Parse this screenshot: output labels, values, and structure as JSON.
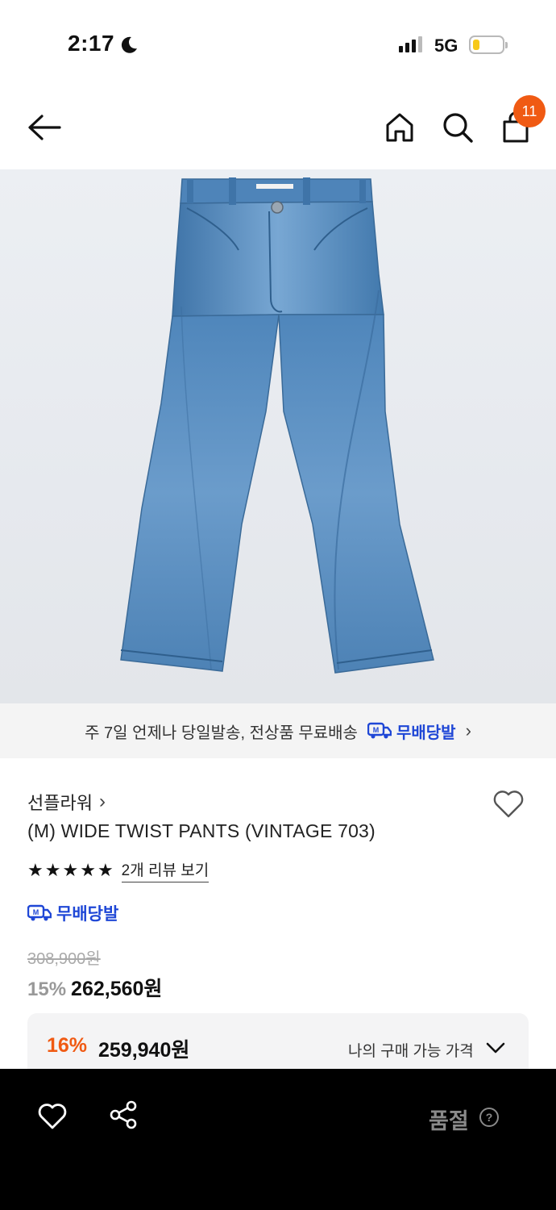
{
  "status_bar": {
    "time": "2:17",
    "network": "5G"
  },
  "top_nav": {
    "cart_count": "11"
  },
  "shipping_banner": {
    "text": "주 7일 언제나 당일발송, 전상품 무료배송",
    "badge_label": "무배당발",
    "badge_icon_text": "M"
  },
  "product": {
    "brand": "선플라워",
    "brand_chevron": "›",
    "name": "(M) WIDE TWIST PANTS (VINTAGE 703)",
    "rating_stars": 5,
    "review_link": "2개 리뷰 보기",
    "tag_label": "무배당발",
    "tag_icon_text": "M",
    "original_price": "308,900원",
    "discount_rate": "15%",
    "sale_price": "262,560원"
  },
  "my_price": {
    "rate": "16%",
    "price": "259,940원",
    "label": "나의 구매 가능 가격"
  },
  "bottom_bar": {
    "status_label": "품절"
  },
  "colors": {
    "accent_orange": "#f05a13",
    "mubae_blue": "#1f47d6",
    "denim": "#5b8fbf"
  },
  "icons": [
    "back-arrow-icon",
    "home-icon",
    "search-icon",
    "shopping-bag-icon",
    "heart-icon",
    "share-icon",
    "help-circle-icon",
    "chevron-down-icon",
    "moon-icon"
  ]
}
